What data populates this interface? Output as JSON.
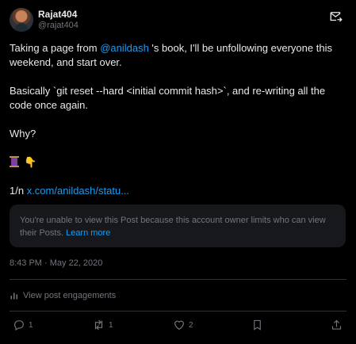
{
  "author": {
    "display_name": "Rajat404",
    "handle": "@rajat404"
  },
  "post": {
    "line1_prefix": "Taking a page from ",
    "mention": "@anildash",
    "line1_suffix": " 's book, I'll be unfollowing everyone this weekend, and start over.",
    "line2": "Basically `git reset --hard <initial commit hash>`, and re-writing all the code once again.",
    "line3": "Why?",
    "emoji_hand": "👇",
    "thread_prefix": "1/n ",
    "thread_link": "x.com/anildash/statu..."
  },
  "limited_notice": {
    "text": "You're unable to view this Post because this account owner limits who can view their Posts. ",
    "learn_more": "Learn more"
  },
  "timestamp": "8:43 PM · May 22, 2020",
  "engagements_label": "View post engagements",
  "actions": {
    "replies": "1",
    "reposts": "1",
    "likes": "2"
  },
  "icons": {
    "subscribe": "envelope-arrow-icon",
    "engagements": "bar-chart-icon",
    "reply": "speech-bubble-icon",
    "repost": "repost-arrows-icon",
    "like": "heart-icon",
    "bookmark": "bookmark-icon",
    "share": "share-icon"
  },
  "colors": {
    "background": "#000000",
    "text": "#e7e9ea",
    "muted": "#71767b",
    "link": "#1d9bf0",
    "card": "#16181c",
    "divider": "#2f3336"
  }
}
